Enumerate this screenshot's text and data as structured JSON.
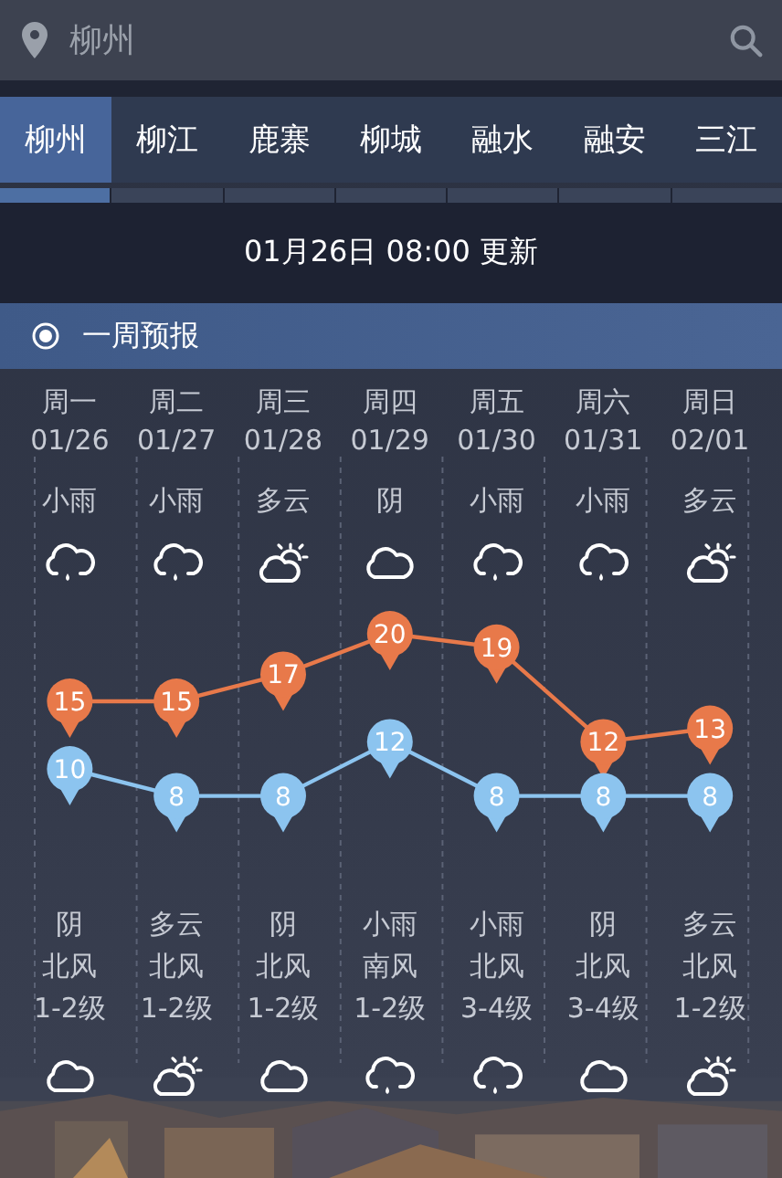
{
  "search": {
    "value": "柳州"
  },
  "tabs": [
    {
      "label": "柳州",
      "selected": true
    },
    {
      "label": "柳江",
      "selected": false
    },
    {
      "label": "鹿寨",
      "selected": false
    },
    {
      "label": "柳城",
      "selected": false
    },
    {
      "label": "融水",
      "selected": false
    },
    {
      "label": "融安",
      "selected": false
    },
    {
      "label": "三江",
      "selected": false
    }
  ],
  "update_time": "01月26日 08:00 更新",
  "section": {
    "title": "一周预报"
  },
  "days": [
    {
      "weekday": "周一",
      "date": "01/26",
      "day_weather": "小雨",
      "day_icon": {
        "kind": "rain"
      },
      "night_weather": "阴",
      "wind_direction": "北风",
      "wind_level": "1-2级",
      "night_icon": {
        "kind": "cloud"
      }
    },
    {
      "weekday": "周二",
      "date": "01/27",
      "day_weather": "小雨",
      "day_icon": {
        "kind": "rain"
      },
      "night_weather": "多云",
      "wind_direction": "北风",
      "wind_level": "1-2级",
      "night_icon": {
        "kind": "partly"
      }
    },
    {
      "weekday": "周三",
      "date": "01/28",
      "day_weather": "多云",
      "day_icon": {
        "kind": "partly"
      },
      "night_weather": "阴",
      "wind_direction": "北风",
      "wind_level": "1-2级",
      "night_icon": {
        "kind": "cloud"
      }
    },
    {
      "weekday": "周四",
      "date": "01/29",
      "day_weather": "阴",
      "day_icon": {
        "kind": "cloud"
      },
      "night_weather": "小雨",
      "wind_direction": "南风",
      "wind_level": "1-2级",
      "night_icon": {
        "kind": "rain"
      }
    },
    {
      "weekday": "周五",
      "date": "01/30",
      "day_weather": "小雨",
      "day_icon": {
        "kind": "rain"
      },
      "night_weather": "小雨",
      "wind_direction": "北风",
      "wind_level": "3-4级",
      "night_icon": {
        "kind": "rain"
      }
    },
    {
      "weekday": "周六",
      "date": "01/31",
      "day_weather": "小雨",
      "day_icon": {
        "kind": "rain"
      },
      "night_weather": "阴",
      "wind_direction": "北风",
      "wind_level": "3-4级",
      "night_icon": {
        "kind": "cloud"
      }
    },
    {
      "weekday": "周日",
      "date": "02/01",
      "day_weather": "多云",
      "day_icon": {
        "kind": "partly"
      },
      "night_weather": "多云",
      "wind_direction": "北风",
      "wind_level": "1-2级",
      "night_icon": {
        "kind": "partly"
      }
    }
  ],
  "chart_data": {
    "type": "line",
    "data_labels": true,
    "series": [
      {
        "color": "#e8794a",
        "marker": "circle",
        "values": [
          15,
          15,
          17,
          20,
          19,
          12,
          13
        ]
      },
      {
        "color": "#8cc4ef",
        "marker": "circle",
        "values": [
          10,
          8,
          8,
          12,
          8,
          8,
          8
        ]
      }
    ]
  }
}
